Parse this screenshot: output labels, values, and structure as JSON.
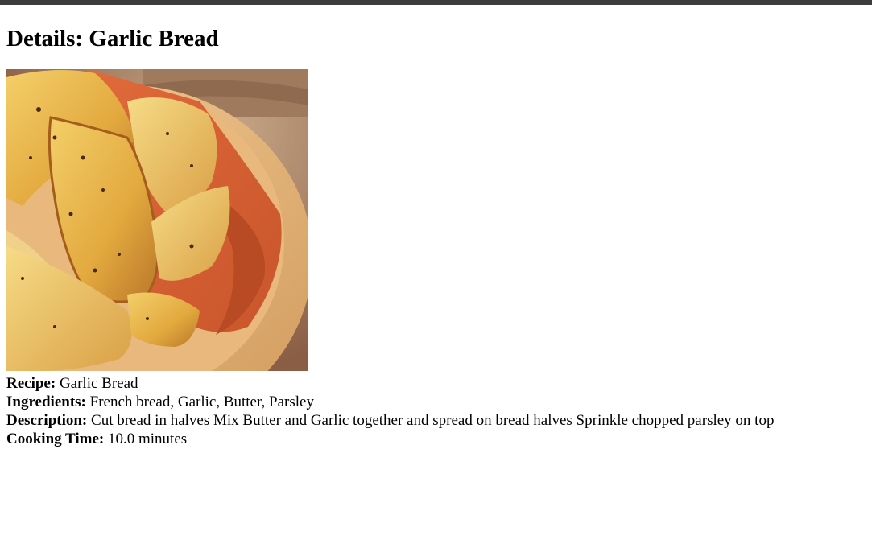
{
  "page": {
    "title_prefix": "Details: ",
    "title_name": "Garlic Bread"
  },
  "image": {
    "alt": "Garlic Bread",
    "subject": "toasted garlic bread pieces in a wooden bowl with an orange cloth"
  },
  "details": {
    "recipe_label": "Recipe:",
    "recipe_value": "Garlic Bread",
    "ingredients_label": "Ingredients:",
    "ingredients_value": "French bread, Garlic, Butter, Parsley",
    "description_label": "Description:",
    "description_value": "Cut bread in halves Mix Butter and Garlic together and spread on bread halves Sprinkle chopped parsley on top",
    "cooking_time_label": "Cooking Time:",
    "cooking_time_value": "10.0 minutes"
  },
  "colors": {
    "top_bar": "#3c3c3c",
    "background": "#ffffff",
    "text": "#000000"
  }
}
